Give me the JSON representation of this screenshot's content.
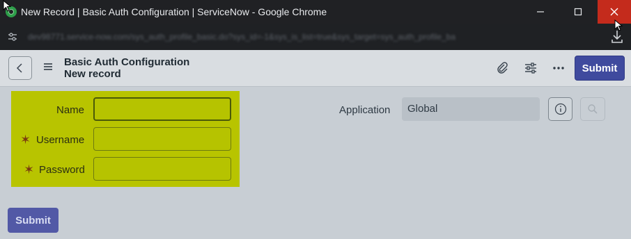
{
  "window": {
    "title": "New Record | Basic Auth Configuration | ServiceNow - Google Chrome",
    "url_blurred": "dev98771.service-now.com/sys_auth_profile_basic.do?sys_id=-1&sys_is_list=true&sys_target=sys_auth_profile_ba"
  },
  "header": {
    "title": "Basic Auth Configuration",
    "subtitle": "New record",
    "submit_label": "Submit"
  },
  "form": {
    "name_label": "Name",
    "username_label": "Username",
    "password_label": "Password",
    "required_mark": "✶",
    "name_value": "",
    "username_value": "",
    "password_value": "",
    "application_label": "Application",
    "application_value": "Global"
  },
  "footer": {
    "submit_label": "Submit"
  },
  "colors": {
    "highlight": "#b8c400",
    "primary_button": "#3f4a9e",
    "close_button": "#c42b1c"
  }
}
